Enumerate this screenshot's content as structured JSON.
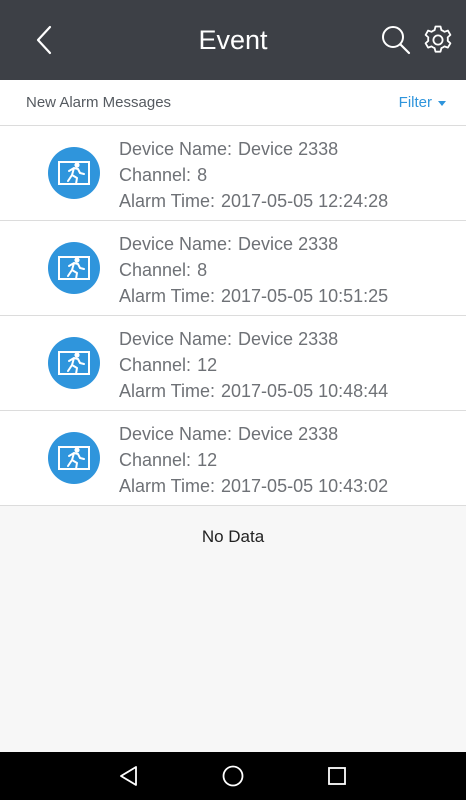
{
  "header": {
    "title": "Event"
  },
  "subbar": {
    "label": "New Alarm Messages",
    "filter_label": "Filter"
  },
  "labels": {
    "device_name": "Device Name:",
    "channel": "Channel:",
    "alarm_time": "Alarm Time:"
  },
  "events": [
    {
      "device_name": "Device 2338",
      "channel": "8",
      "alarm_time": "2017-05-05 12:24:28"
    },
    {
      "device_name": "Device 2338",
      "channel": "8",
      "alarm_time": "2017-05-05 10:51:25"
    },
    {
      "device_name": "Device 2338",
      "channel": "12",
      "alarm_time": "2017-05-05 10:48:44"
    },
    {
      "device_name": "Device 2338",
      "channel": "12",
      "alarm_time": "2017-05-05 10:43:02"
    }
  ],
  "empty_text": "No Data",
  "colors": {
    "header_bg": "#3d4046",
    "accent": "#2f95dc",
    "text_secondary": "#6e7176"
  },
  "icons": {
    "back": "chevron-left-icon",
    "search": "search-icon",
    "settings": "gear-icon",
    "event": "exit-running-icon",
    "nav_back": "triangle-back-icon",
    "nav_home": "circle-home-icon",
    "nav_recent": "square-recent-icon"
  }
}
